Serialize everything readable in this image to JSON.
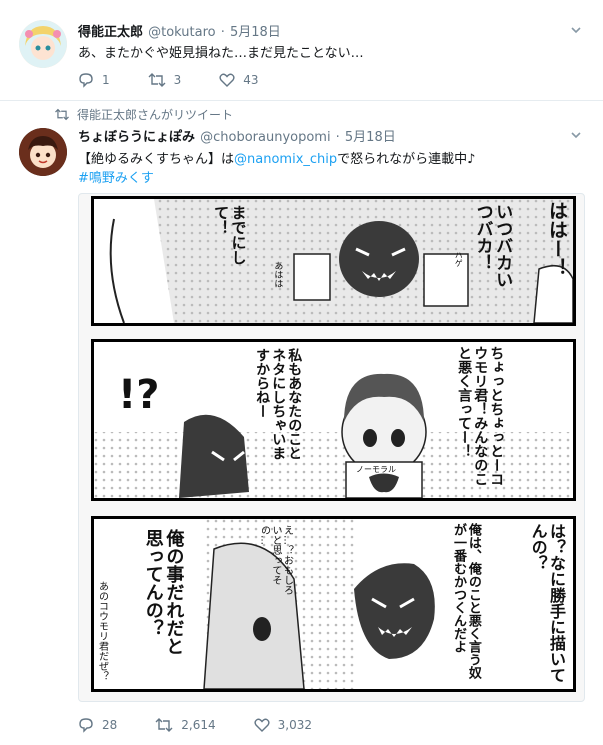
{
  "tweet1": {
    "name": "得能正太郎",
    "handle": "@tokutaro",
    "dot": "·",
    "date": "5月18日",
    "text": "あ、またかぐや姫見損ねた…まだ見たことない…",
    "replies": "1",
    "retweets": "3",
    "likes": "43"
  },
  "retweet_banner": "得能正太郎さんがリツイート",
  "tweet2": {
    "name": "ちょぼらうにょぽみ",
    "handle": "@choboraunyopomi",
    "dot": "·",
    "date": "5月18日",
    "text_prefix": "【絶ゆるみくすちゃん】は",
    "mention": "@nanomix_chip",
    "text_suffix": "で怒られながら連載中♪",
    "hashtag": "#鳴野みくす",
    "replies": "28",
    "retweets": "2,614",
    "likes": "3,032"
  },
  "comic": {
    "panel1": {
      "bubble_a": "ははー！",
      "bubble_b": "までにして！",
      "bubble_c": "いつバカいつバカ！",
      "sfx": "あはは",
      "doodle_note": "ハゲ"
    },
    "panel2": {
      "exclaim": "!?",
      "bubble_a": "私もあなたのことネタにしちゃいますからねー",
      "bubble_b": "ちょっとちょっとーコウモリ君！みんなのこと悪く言ってー！",
      "sign": "ノーモラル"
    },
    "panel3": {
      "bubble_a": "俺の事だれだと思ってんの？",
      "bubble_b": "え…？おもしろいと思ってその…",
      "bubble_c": "は？なに勝手に描いてんの？",
      "bubble_d": "俺は、俺のこと悪く言う奴が一番むかつくんだよ",
      "caption": "あのコウモリ君だぜ？"
    }
  },
  "colors": {
    "link": "#1da1f2",
    "meta": "#657786",
    "border": "#e6ecf0"
  }
}
